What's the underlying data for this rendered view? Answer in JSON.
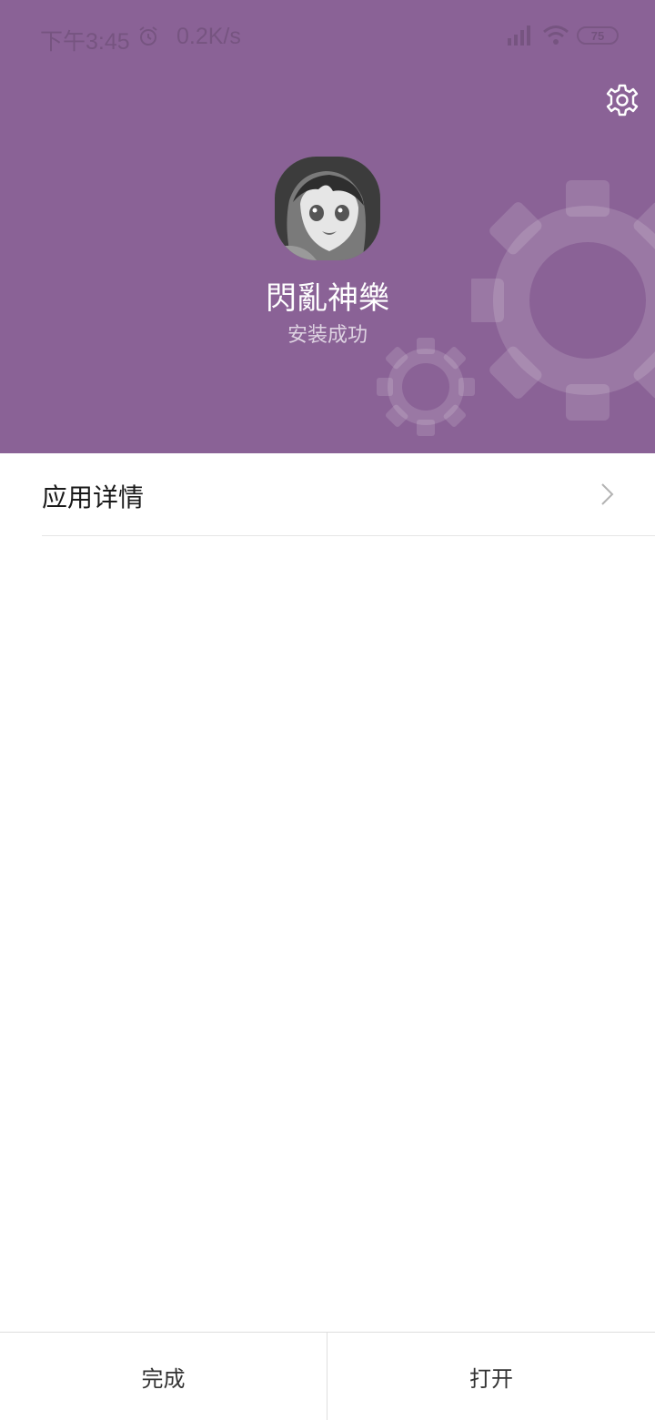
{
  "status_bar": {
    "time": "下午3:45",
    "net_speed": "0.2K/s",
    "battery": "75",
    "icons": [
      "alarm-icon",
      "signal-icon",
      "wifi-icon",
      "battery-icon"
    ]
  },
  "header": {
    "background_color": "#8a6296",
    "app_name": "閃亂神樂",
    "install_status": "安装成功",
    "settings_icon": "gear-icon"
  },
  "details": {
    "label": "应用详情",
    "chevron_icon": "chevron-right-icon"
  },
  "actions": {
    "done_label": "完成",
    "open_label": "打开"
  }
}
